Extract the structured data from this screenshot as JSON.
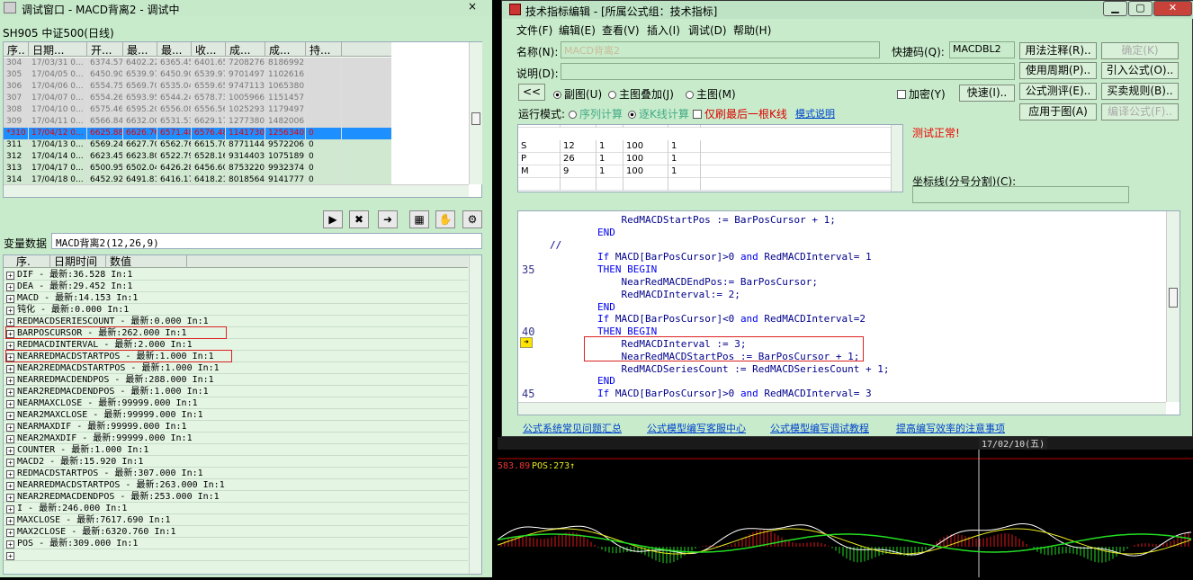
{
  "left_window": {
    "title": "调试窗口 - MACD背离2 - 调试中",
    "close": "×",
    "stock": "SH905 中证500(日线)",
    "columns": [
      "序..",
      "日期...",
      "开...",
      "最...",
      "最...",
      "收...",
      "成...",
      "成...",
      "持..."
    ],
    "rows": [
      {
        "c": [
          "304",
          "17/03/31 0...",
          "6374.57",
          "6402.22",
          "6365.45",
          "6401.65",
          "72082768",
          "8186992...",
          ""
        ],
        "s": "old"
      },
      {
        "c": [
          "305",
          "17/04/05 0...",
          "6450.90",
          "6539.97",
          "6450.90",
          "6539.97",
          "97014976",
          "1102616...",
          ""
        ],
        "s": "old"
      },
      {
        "c": [
          "306",
          "17/04/06 0...",
          "6554.75",
          "6569.70",
          "6535.04",
          "6559.65",
          "97471136",
          "1065380...",
          ""
        ],
        "s": "old"
      },
      {
        "c": [
          "307",
          "17/04/07 0...",
          "6554.26",
          "6593.95",
          "6544.24",
          "6578.73",
          "1005966...",
          "1151457...",
          ""
        ],
        "s": "old"
      },
      {
        "c": [
          "308",
          "17/04/10 0...",
          "6575.46",
          "6595.20",
          "6556.08",
          "6556.56",
          "1025293...",
          "1179497...",
          ""
        ],
        "s": "old"
      },
      {
        "c": [
          "309",
          "17/04/11 0...",
          "6566.84",
          "6632.00",
          "6531.53",
          "6629.17",
          "1277380...",
          "1482006...",
          ""
        ],
        "s": "old"
      },
      {
        "c": [
          "*310",
          "17/04/12 0...",
          "6625.88",
          "6626.76",
          "6571.48",
          "6576.48",
          "1141730...",
          "1256340...",
          "0"
        ],
        "s": "sel"
      },
      {
        "c": [
          "311",
          "17/04/13 0...",
          "6569.24",
          "6627.70",
          "6562.76",
          "6615.70",
          "87711440",
          "9572206...",
          "0"
        ],
        "s": "nm"
      },
      {
        "c": [
          "312",
          "17/04/14 0...",
          "6623.45",
          "6623.80",
          "6522.79",
          "6528.16",
          "93144032",
          "1075189...",
          "0"
        ],
        "s": "nm"
      },
      {
        "c": [
          "313",
          "17/04/17 0...",
          "6500.95",
          "6502.04",
          "6426.28",
          "6456.60",
          "87532208",
          "9932374...",
          "0"
        ],
        "s": "nm"
      },
      {
        "c": [
          "314",
          "17/04/18 0...",
          "6452.92",
          "6491.81",
          "6416.17",
          "6418.21",
          "80185640",
          "9141777...",
          "0"
        ],
        "s": "nm"
      }
    ],
    "tool_icons": [
      "go-to-icon",
      "clear-icon",
      "arrow-right-icon",
      "chart-icon",
      "hand-icon",
      "settings-icon"
    ],
    "var_label": "变量数据",
    "var_value": "MACD背离2(12,26,9)",
    "var_columns": [
      "序.",
      "日期时间",
      "数值"
    ],
    "vars": [
      "DIF  -  最新:36.528   In:1",
      "DEA  -  最新:29.452   In:1",
      "MACD  -  最新:14.153   In:1",
      "钝化  -  最新:0.000   In:1",
      "REDMACDSERIESCOUNT  -  最新:0.000   In:1",
      "BARPOSCURSOR  -  最新:262.000   In:1",
      "REDMACDINTERVAL  -  最新:2.000   In:1",
      "NEARREDMACDSTARTPOS  -  最新:1.000   In:1",
      "NEAR2REDMACDSTARTPOS  -  最新:1.000   In:1",
      "NEARREDMACDENDPOS  -  最新:288.000   In:1",
      "NEAR2REDMACDENDPOS  -  最新:1.000   In:1",
      "NEARMAXCLOSE  -  最新:99999.000   In:1",
      "NEAR2MAXCLOSE  -  最新:99999.000   In:1",
      "NEARMAXDIF  -  最新:99999.000   In:1",
      "NEAR2MAXDIF  -  最新:99999.000   In:1",
      "COUNTER  -  最新:1.000   In:1",
      "MACD2  -  最新:15.920   In:1",
      "REDMACDSTARTPOS  -  最新:307.000   In:1",
      "NEARREDMACDSTARTPOS  -  最新:263.000   In:1",
      "NEAR2REDMACDENDPOS  -  最新:253.000   In:1",
      "I  -  最新:246.000   In:1",
      "MAXCLOSE  -  最新:7617.690   In:1",
      "MAX2CLOSE  -  最新:6320.760   In:1",
      "POS  -  最新:309.000   In:1",
      ""
    ]
  },
  "right_window": {
    "title": "技术指标编辑 - [所属公式组：技术指标]",
    "menu": [
      "文件(F)",
      "编辑(E)",
      "查看(V)",
      "插入(I)",
      "调试(D)",
      "帮助(H)"
    ],
    "name_label": "名称(N):",
    "name_value": "MACD背离2",
    "shortcut_label": "快捷码(Q):",
    "shortcut_value": "MACDBL2",
    "desc_label": "说明(D):",
    "back_btn": "<<",
    "radios": [
      "副图(U)",
      "主图叠加(J)",
      "主图(M)"
    ],
    "encrypt": "加密(Y)",
    "quick_btn": "快速(I)..",
    "mode_label": "运行模式:",
    "mode1": "序列计算",
    "mode2": "逐K线计算",
    "mode3": "仅刷最后一根K线",
    "mode_link": "模式说明",
    "buttons": [
      "用法注释(R)..",
      "确定(K)",
      "使用周期(P)..",
      "引入公式(O)..",
      "公式测评(E)..",
      "买卖规则(B)..",
      "应用于图(A)",
      "编译公式(F).."
    ],
    "status": "测试正常!",
    "params": [
      [
        "S",
        "12",
        "1",
        "100",
        "1"
      ],
      [
        "P",
        "26",
        "1",
        "100",
        "1"
      ],
      [
        "M",
        "9",
        "1",
        "100",
        "1"
      ]
    ],
    "axis_label": "坐标线(分号分割)(C):",
    "code": [
      {
        "t": "            RedMACDStartPos := BarPosCursor + 1;",
        "n": ""
      },
      {
        "t": "        END",
        "n": ""
      },
      {
        "t": "//",
        "n": ""
      },
      {
        "t": "        If MACD[BarPosCursor]>0 and RedMACDInterval= 1",
        "n": ""
      },
      {
        "t": "        THEN BEGIN",
        "n": "35"
      },
      {
        "t": "            NearRedMACDEndPos:= BarPosCursor;",
        "n": ""
      },
      {
        "t": "            RedMACDInterval:= 2;",
        "n": ""
      },
      {
        "t": "        END",
        "n": ""
      },
      {
        "t": "        If MACD[BarPosCursor]<0 and RedMACDInterval=2",
        "n": ""
      },
      {
        "t": "        THEN BEGIN",
        "n": "40"
      },
      {
        "t": "            RedMACDInterval := 3;",
        "n": ""
      },
      {
        "t": "            NearRedMACDStartPos := BarPosCursor + 1;",
        "n": ""
      },
      {
        "t": "            RedMACDSeriesCount := RedMACDSeriesCount + 1;",
        "n": ""
      },
      {
        "t": "        END",
        "n": ""
      },
      {
        "t": "        If MACD[BarPosCursor]>0 and RedMACDInterval= 3",
        "n": "45"
      }
    ],
    "links": [
      "公式系统常见问题汇总",
      "公式模型编写客服中心",
      "公式模型编写调试教程",
      "提高编写效率的注意事项"
    ]
  },
  "chart": {
    "readout": "583.89",
    "pos": "POS:273↑",
    "date": "17/02/10(五)",
    "colors": {
      "red": "#e01818",
      "green": "#22dd22",
      "yellow": "#e8e820",
      "white": "#ffffff"
    }
  }
}
